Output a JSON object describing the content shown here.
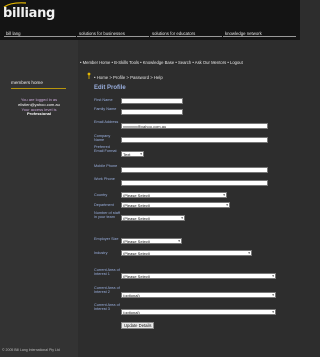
{
  "brand": {
    "logo_text": "billiang"
  },
  "topnav": [
    "bill lang",
    "solutions for businesses",
    "solutions for educators",
    "knowledge network"
  ],
  "membernav": "• Member Home • B-Skills Tools • Knowledge Base • Search • Ask Our Mentors • Logout",
  "sidebar": {
    "title": "members home",
    "logged_in_label": "You are logged in as",
    "email": "ellstien@yahoo.com.au",
    "level_label": "Your access level is",
    "level": "Professional"
  },
  "breadcrumb": "• Home > Profile > Password > Help",
  "form": {
    "title": "Edit Profile",
    "first_name": {
      "label": "First Name",
      "value": ""
    },
    "family_name": {
      "label": "Family Name",
      "value": ""
    },
    "email": {
      "label": "Email Address",
      "value": "xxxxxxx@yahoo.com.au"
    },
    "company": {
      "label": "Company Name",
      "value": ""
    },
    "preferred_format": {
      "label": "Preferred Email Format",
      "value": "Text"
    },
    "mobile": {
      "label": "Mobile Phone",
      "value": ""
    },
    "work_phone": {
      "label": "Work Phone",
      "value": ""
    },
    "country": {
      "label": "Country",
      "value": "(Please Select)"
    },
    "department": {
      "label": "Department",
      "value": "(Please Select)"
    },
    "staff": {
      "label": "Number of staff in your team",
      "value": "(Please Select)"
    },
    "employer_size": {
      "label": "Employer Size",
      "value": "(Please Select)"
    },
    "industry": {
      "label": "Industry",
      "value": "(Please Select)"
    },
    "interest1": {
      "label": "Current Area of Interest 1",
      "value": "(Please Select)"
    },
    "interest2": {
      "label": "Current Area of Interest 2",
      "value": "(optional)"
    },
    "interest3": {
      "label": "Current Area of Interest 3",
      "value": "(optional)"
    },
    "submit": "Update Details"
  },
  "copyright": "© 2005 Bill Lang International Pty Ltd",
  "colors": {
    "label": "#9ab0e0",
    "background": "#2d2d2d",
    "header": "#141414",
    "bullet": "#e6b800"
  }
}
